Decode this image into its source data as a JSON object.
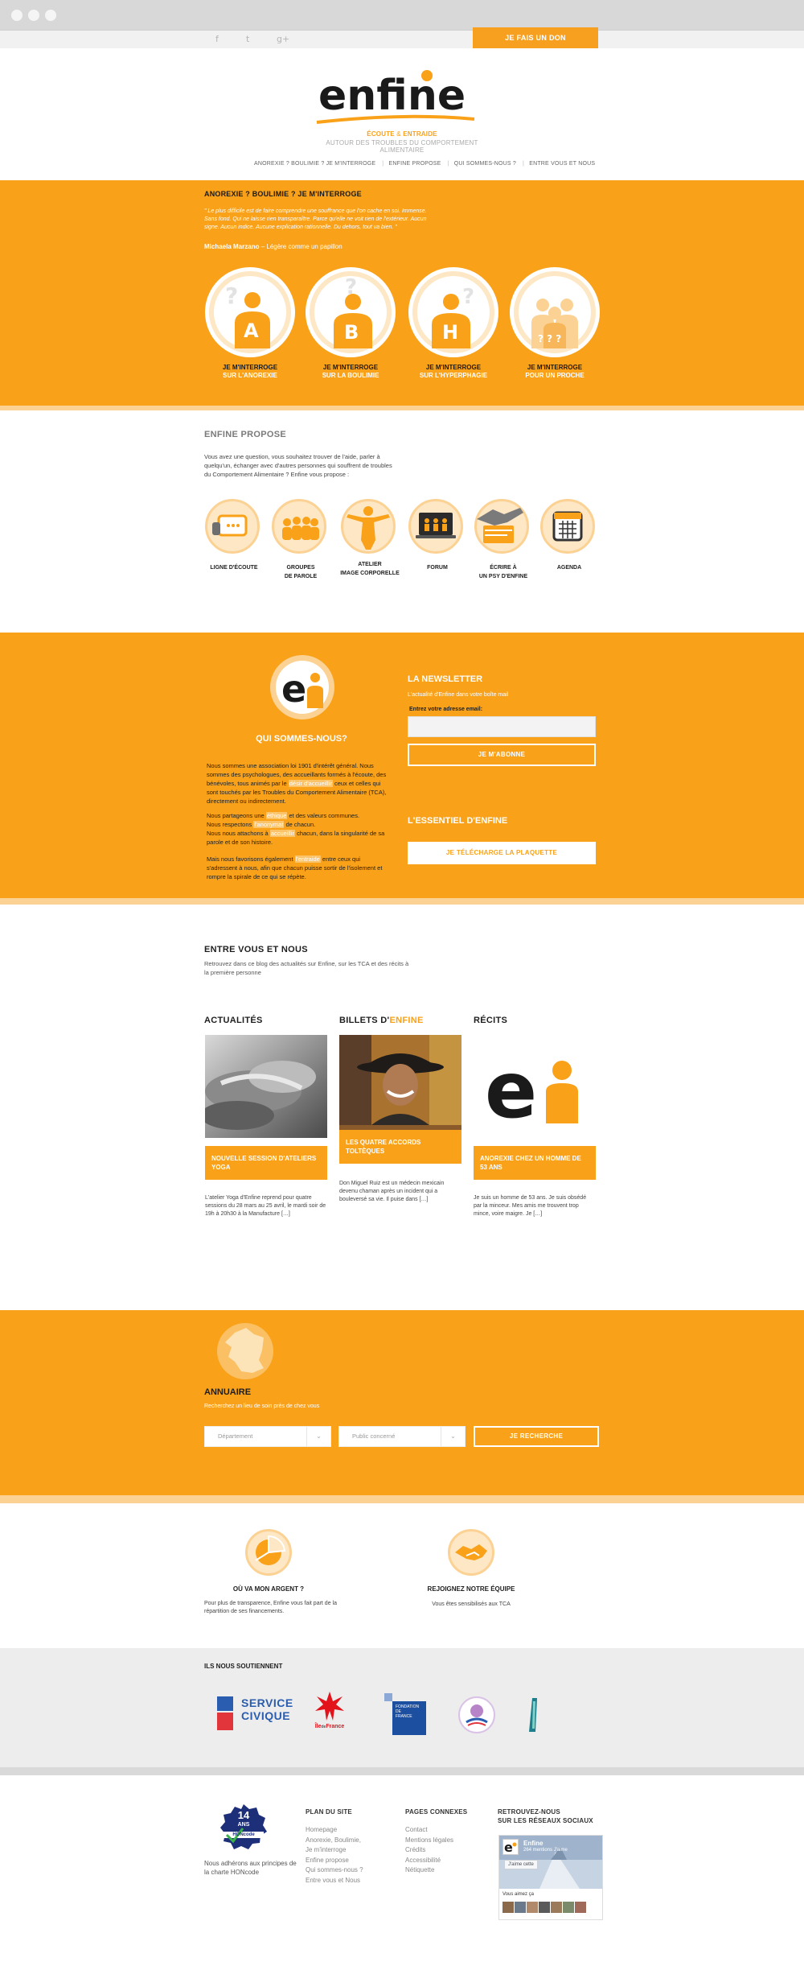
{
  "header": {
    "donate_label": "JE FAIS UN DON",
    "social": [
      {
        "icon": "facebook-icon",
        "glyph": "f"
      },
      {
        "icon": "twitter-icon",
        "glyph": "t"
      },
      {
        "icon": "googleplus-icon",
        "glyph": "g+"
      }
    ],
    "logo_text": "enfine",
    "tagline1_part1": "ÉCOUTE",
    "tagline1_amp": " & ",
    "tagline1_part2": "ENTRAIDE",
    "tagline2": "AUTOUR DES TROUBLES DU COMPORTEMENT ALIMENTAIRE",
    "nav": [
      "ANOREXIE ? BOULIMIE ? JE M'INTERROGE",
      "ENFINE PROPOSE",
      "QUI SOMMES-NOUS ?",
      "ENTRE VOUS ET NOUS"
    ]
  },
  "hero": {
    "title": "ANOREXIE ? BOULIMIE ? JE M'INTERROGE",
    "quote": "\" Le plus difficile est de faire comprendre une souffrance que l'on cache en soi. Immense. Sans fond. Qui ne laisse rien transparaître. Parce qu'elle ne voit rien de l'extérieur. Aucun signe. Aucun indice. Aucune explication rationnelle. Du dehors, tout va bien. \"",
    "author_name": "Michaela Marzano",
    "author_work": " – Légère comme un papillon",
    "circles": [
      {
        "letter": "A",
        "line1": "JE M'INTERROGE",
        "line2": "SUR L'ANOREXIE"
      },
      {
        "letter": "B",
        "line1": "JE M'INTERROGE",
        "line2": "SUR LA BOULIMIE"
      },
      {
        "letter": "H",
        "line1": "JE M'INTERROGE",
        "line2": "SUR L'HYPERPHAGIE"
      },
      {
        "letter": "",
        "line1": "JE M'INTERROGE",
        "line2": "POUR UN PROCHE"
      }
    ]
  },
  "propose": {
    "title": "ENFINE PROPOSE",
    "intro": "Vous avez une question, vous souhaitez trouver de l'aide, parler à quelqu'un, échanger avec d'autres personnes qui souffrent de troubles du Comportement Alimentaire ? Enfine vous propose :",
    "items": [
      {
        "icon": "listening-line-icon",
        "line1": "LIGNE D'ÉCOUTE",
        "line2": ""
      },
      {
        "icon": "talk-groups-icon",
        "line1": "GROUPES",
        "line2": "DE PAROLE"
      },
      {
        "icon": "body-image-icon",
        "line1": "ATELIER",
        "line2": "IMAGE CORPORELLE"
      },
      {
        "icon": "forum-icon",
        "line1": "FORUM",
        "line2": ""
      },
      {
        "icon": "write-psy-icon",
        "line1": "ÉCRIRE À",
        "line2": "UN PSY D'ENFINE"
      },
      {
        "icon": "agenda-icon",
        "line1": "AGENDA",
        "line2": ""
      }
    ]
  },
  "who": {
    "title": "QUI SOMMES-NOUS?",
    "p1_a": "Nous sommes une association loi 1901 d'intérêt général. Nous sommes des psychologues, des accueillants formés à l'écoute, des bénévoles, tous animés par le ",
    "p1_hl": "désir d'accueillir",
    "p1_b": " ceux et celles qui sont touchés par les Troubles du Comportement Alimentaire (TCA), directement ou indirectement.",
    "p2_a": "Nous partageons une ",
    "p2_hl1": "éthique",
    "p2_b": " et des valeurs communes.",
    "p2_c": "Nous respectons ",
    "p2_hl2": "l'anonymat",
    "p2_d": " de chacun.",
    "p2_e": "Nous nous attachons à ",
    "p2_hl3": "accueillir",
    "p2_f": " chacun, dans la singularité de sa parole et de son histoire.",
    "p3_a": "Mais nous favorisons également ",
    "p3_hl": "l'entraide",
    "p3_b": " entre ceux qui s'adressent à nous, afin que chacun puisse sortir de l'isolement et rompre la spirale de ce qui se répète.",
    "newsletter_title": "LA NEWSLETTER",
    "newsletter_sub": "L'actualité d'Enfine dans votre boîte mail",
    "email_label": "Entrez votre adresse email:",
    "email_value": "",
    "subscribe_label": "JE M'ABONNE",
    "essentiel_title": "L'ESSENTIEL D'ENFINE",
    "download_label": "JE TÉLÉCHARGE LA PLAQUETTE"
  },
  "blog": {
    "title": "ENTRE VOUS ET NOUS",
    "intro": "Retrouvez dans ce blog des actualités sur Enfine, sur les TCA et des récits à la première personne",
    "columns": [
      {
        "title_a": "ACTUALITÉS",
        "title_b": "",
        "tag": "NOUVELLE SESSION D'ATELIERS YOGA",
        "excerpt": "L'atelier Yoga d'Enfine reprend pour quatre sessions du 28 mars au 25 avril, le mardi soir de 19h à 20h30 à la Manufacture […]"
      },
      {
        "title_a": "BILLETS D'",
        "title_b": "ENFINE",
        "tag": "LES QUATRE ACCORDS TOLTÈQUES",
        "excerpt": "Don Miguel Ruiz est un médecin mexicain devenu chaman après un incident qui a bouleversé sa vie. Il puise dans […]"
      },
      {
        "title_a": "RÉCITS",
        "title_b": "",
        "tag": "ANOREXIE CHEZ UN HOMME DE 53 ANS",
        "excerpt": "Je suis un homme de 53 ans. Je suis obsédé par la minceur. Mes amis me trouvent trop mince, voire maigre. Je […]"
      }
    ]
  },
  "annuaire": {
    "title": "ANNUAIRE",
    "sub": "Recherchez un lieu de soin près de chez vous",
    "department_placeholder": "Département",
    "public_placeholder": "Public concerné",
    "search_label": "JE RECHERCHE"
  },
  "money": {
    "title": "OÙ VA MON ARGENT ?",
    "text": "Pour plus de transparence, Enfine vous fait part de la répartition de ses financements."
  },
  "team": {
    "title": "REJOIGNEZ NOTRE ÉQUIPE",
    "text": "Vous êtes sensibilisés aux TCA"
  },
  "partners": {
    "title": "ILS NOUS SOUTIENNENT",
    "service_civique_1": "SERVICE",
    "service_civique_2": "CIVIQUE",
    "idf_a": "Île",
    "idf_b": "de",
    "idf_c": "France",
    "fondation_1": "FONDATION",
    "fondation_2": "DE",
    "fondation_3": "FRANCE"
  },
  "footer": {
    "hon_years": "14",
    "hon_ans": "ANS",
    "hon_code": "HONcode",
    "hon_text": "Nous adhérons aux principes de la charte HONcode",
    "plan_title": "PLAN DU SITE",
    "plan_links": [
      "Homepage",
      "Anorexie, Boulimie,",
      "Je m'interroge",
      "Enfine propose",
      "Qui sommes-nous ?",
      "Entre vous et Nous"
    ],
    "pages_title": "PAGES CONNEXES",
    "pages_links": [
      "Contact",
      "Mentions légales",
      "Crédits",
      "Accessibilité",
      "Nétiquette"
    ],
    "social_title_1": "RETROUVEZ-NOUS",
    "social_title_2": "SUR LES RÉSEAUX SOCIAUX",
    "fb_name": "Enfine",
    "fb_likes": "264 mentions J'aime",
    "fb_like_btn": "J'aime cette",
    "fb_friends": "Vous aimez ça"
  }
}
